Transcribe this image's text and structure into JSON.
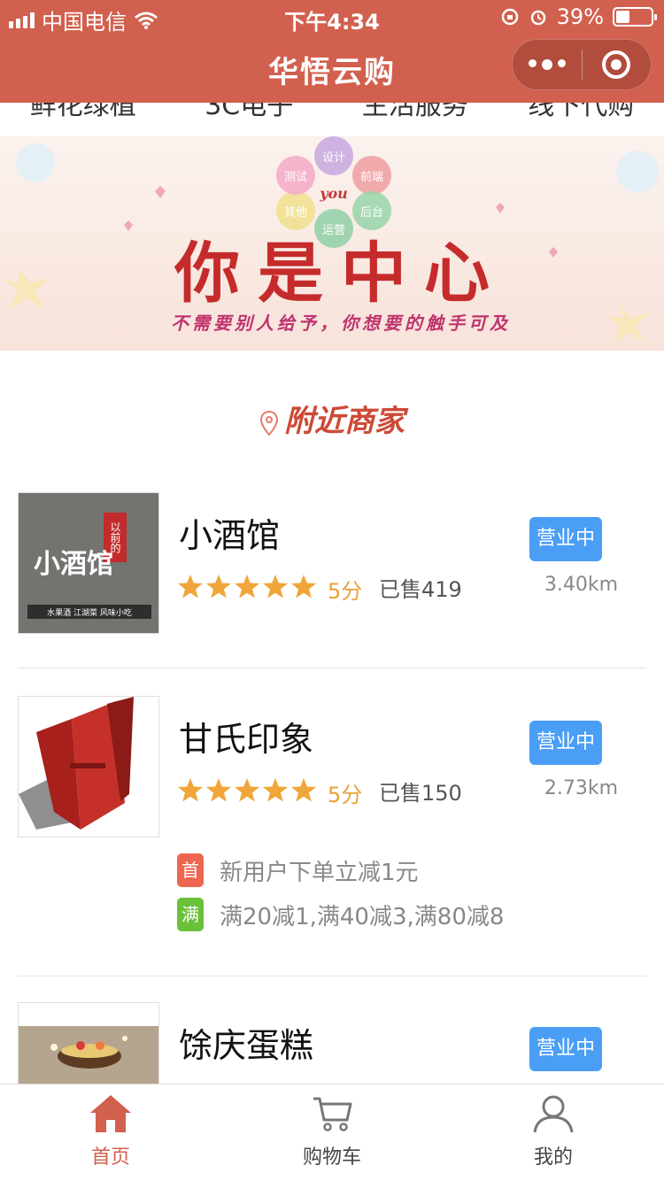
{
  "status_bar": {
    "carrier": "中国电信",
    "time": "下午4:34",
    "battery": "39%",
    "battery_level": 0.39
  },
  "nav": {
    "title": "华悟云购"
  },
  "categories": [
    "鲜花绿植",
    "3C电子",
    "生活服务",
    "线下代购"
  ],
  "banner": {
    "petals": [
      "设计",
      "前端",
      "后台",
      "运营",
      "其他",
      "测试"
    ],
    "center": "you",
    "headline": "你是中心",
    "tagline": "不需要别人给予，你想要的触手可及"
  },
  "section": {
    "title": "附近商家"
  },
  "shops": [
    {
      "name": "小酒馆",
      "rating_stars": 5,
      "score": "5分",
      "sold": "已售419",
      "distance": "3.40km",
      "status": "营业中",
      "thumb_text": [
        "以前的",
        "小酒馆",
        "水果酒  江湖菜  风味小吃"
      ]
    },
    {
      "name": "甘氏印象",
      "rating_stars": 5,
      "score": "5分",
      "sold": "已售150",
      "distance": "2.73km",
      "status": "营业中",
      "promos": [
        {
          "tag": "首",
          "text": "新用户下单立减1元",
          "color": "#ef6650"
        },
        {
          "tag": "满",
          "text": "满20减1,满40减3,满80减8",
          "color": "#6cc13a"
        }
      ]
    },
    {
      "name": "馀庆蛋糕",
      "status": "营业中"
    }
  ],
  "tabbar": {
    "items": [
      {
        "label": "首页",
        "icon": "home-icon"
      },
      {
        "label": "购物车",
        "icon": "cart-icon"
      },
      {
        "label": "我的",
        "icon": "user-icon"
      }
    ],
    "active_index": 0
  },
  "colors": {
    "brand": "#d2604e",
    "status_blue": "#4a9ef5",
    "star": "#f0a63a"
  }
}
